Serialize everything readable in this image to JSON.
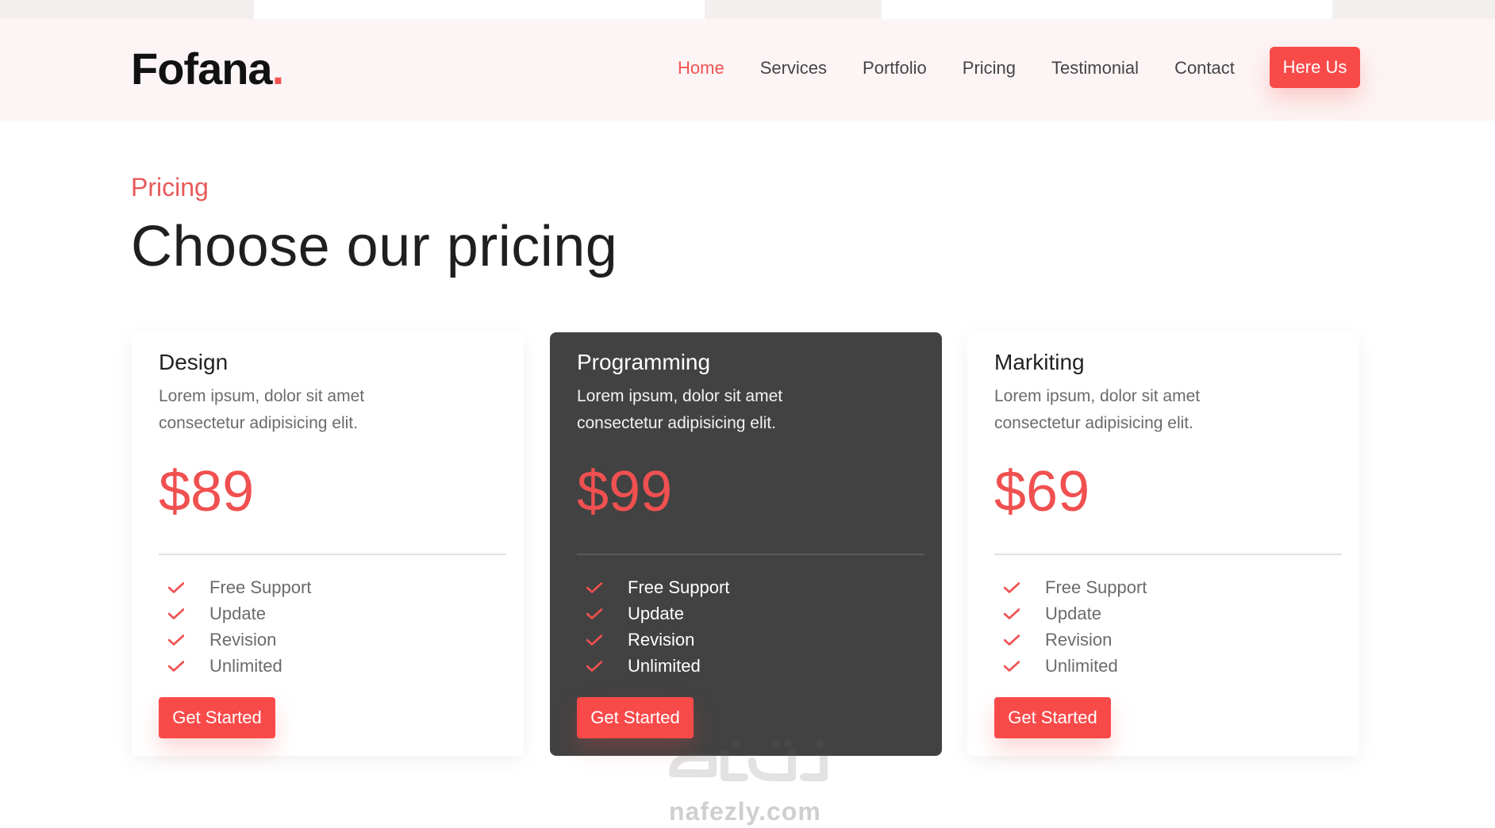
{
  "brand": {
    "name": "Fofana",
    "dot": "."
  },
  "nav": {
    "items": [
      {
        "label": "Home",
        "active": true
      },
      {
        "label": "Services",
        "active": false
      },
      {
        "label": "Portfolio",
        "active": false
      },
      {
        "label": "Pricing",
        "active": false
      },
      {
        "label": "Testimonial",
        "active": false
      },
      {
        "label": "Contact",
        "active": false
      }
    ],
    "cta_label": "Here Us"
  },
  "section": {
    "eyebrow": "Pricing",
    "title": "Choose our pricing"
  },
  "plans": [
    {
      "name": "Design",
      "desc": "Lorem ipsum, dolor sit amet consectetur adipisicing elit.",
      "price": "$89",
      "features": [
        "Free Support",
        "Update",
        "Revision",
        "Unlimited"
      ],
      "cta": "Get Started",
      "featured": false
    },
    {
      "name": "Programming",
      "desc": "Lorem ipsum, dolor sit amet consectetur adipisicing elit.",
      "price": "$99",
      "features": [
        "Free Support",
        "Update",
        "Revision",
        "Unlimited"
      ],
      "cta": "Get Started",
      "featured": true
    },
    {
      "name": "Markiting",
      "desc": "Lorem ipsum, dolor sit amet consectetur adipisicing elit.",
      "price": "$69",
      "features": [
        "Free Support",
        "Update",
        "Revision",
        "Unlimited"
      ],
      "cta": "Get Started",
      "featured": false
    }
  ],
  "watermark": {
    "text": "nafezly.com"
  },
  "colors": {
    "accent": "#f94a4a",
    "featured_bg": "#424242",
    "header_bg": "#fdf5f5"
  }
}
